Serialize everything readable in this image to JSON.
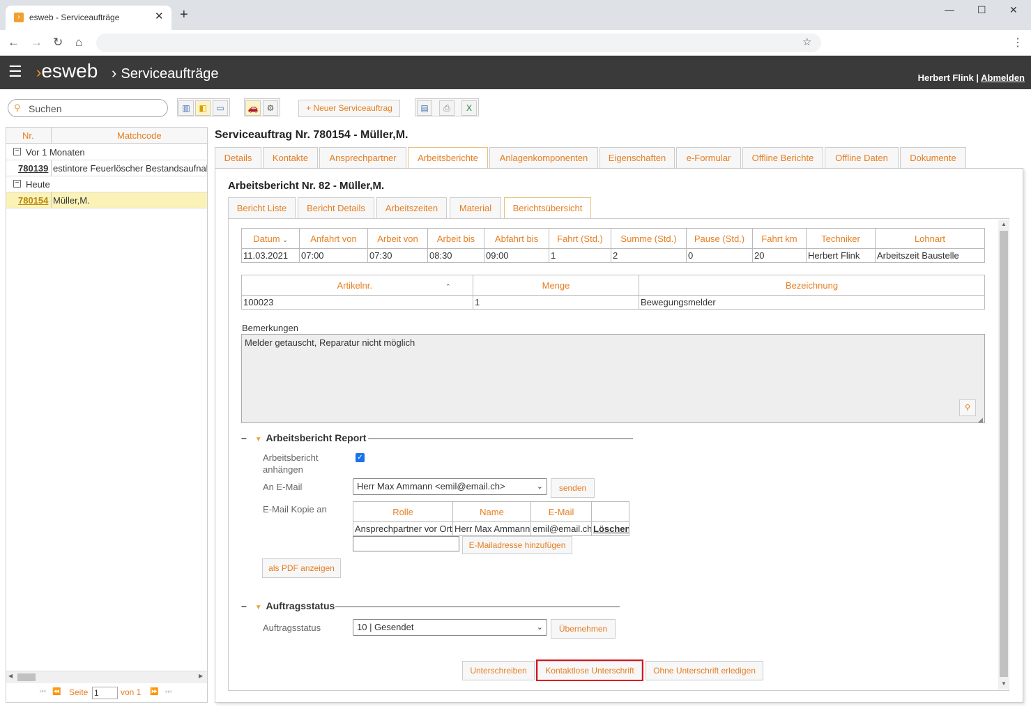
{
  "browser": {
    "tab_title": "esweb - Serviceaufträge",
    "tab_close": "✕",
    "new_tab": "+"
  },
  "app": {
    "logo": "esweb",
    "page_title": "Serviceaufträge",
    "user_name": "Herbert Flink",
    "separator": "|",
    "logout": "Abmelden"
  },
  "toolbar": {
    "search_placeholder": "Suchen",
    "new_order": "Neuer Serviceauftrag"
  },
  "left_list": {
    "col_nr": "Nr.",
    "col_matchcode": "Matchcode",
    "groups": [
      {
        "label": "Vor 1 Monaten",
        "toggle": "−",
        "rows": [
          {
            "nr": "780139",
            "matchcode": "estintore Feuerlöscher Bestandsaufnahme"
          }
        ]
      },
      {
        "label": "Heute",
        "toggle": "−",
        "rows": [
          {
            "nr": "780154",
            "matchcode": "Müller,M."
          }
        ]
      }
    ],
    "pager": {
      "page_label": "Seite",
      "page_value": "1",
      "of_label": "von 1"
    }
  },
  "main": {
    "title": "Serviceauftrag Nr. 780154 - Müller,M.",
    "tabs": [
      "Details",
      "Kontakte",
      "Ansprechpartner",
      "Arbeitsberichte",
      "Anlagenkomponenten",
      "Eigenschaften",
      "e-Formular",
      "Offline Berichte",
      "Offline Daten",
      "Dokumente"
    ],
    "active_tab": "Arbeitsberichte"
  },
  "report": {
    "title": "Arbeitsbericht Nr. 82 - Müller,M.",
    "tabs": [
      "Bericht Liste",
      "Bericht Details",
      "Arbeitszeiten",
      "Material",
      "Berichtsübersicht"
    ],
    "active_tab": "Berichtsübersicht",
    "time_table": {
      "headers": [
        "Datum",
        "Anfahrt von",
        "Arbeit von",
        "Arbeit bis",
        "Abfahrt bis",
        "Fahrt (Std.)",
        "Summe (Std.)",
        "Pause (Std.)",
        "Fahrt km",
        "Techniker",
        "Lohnart"
      ],
      "rows": [
        [
          "11.03.2021",
          "07:00",
          "07:30",
          "08:30",
          "09:00",
          "1",
          "2",
          "0",
          "20",
          "Herbert Flink",
          "Arbeitszeit Baustelle"
        ]
      ]
    },
    "material_table": {
      "headers": [
        "Artikelnr.",
        "Menge",
        "Bezeichnung"
      ],
      "rows": [
        [
          "100023",
          "1",
          "Bewegungsmelder"
        ]
      ]
    },
    "remarks_label": "Bemerkungen",
    "remarks_value": "Melder getauscht, Reparatur nicht möglich",
    "report_section": {
      "collapse": "–",
      "title": "Arbeitsbericht Report",
      "attach_label_1": "Arbeitsbericht",
      "attach_label_2": "anhängen",
      "attach_checked": true,
      "email_label": "An E-Mail",
      "email_value": "Herr Max Ammann <emil@email.ch>",
      "send_button": "senden",
      "cc_label": "E-Mail Kopie an",
      "cc_table": {
        "headers": [
          "Rolle",
          "Name",
          "E-Mail",
          ""
        ],
        "rows": [
          [
            "Ansprechpartner vor Ort",
            "Herr Max Ammann",
            "emil@email.ch",
            "Löschen"
          ]
        ]
      },
      "add_email_button": "E-Mailadresse hinzufügen",
      "pdf_button": "als PDF anzeigen"
    },
    "status_section": {
      "collapse": "–",
      "title": "Auftragsstatus",
      "label": "Auftragsstatus",
      "value": "10 | Gesendet",
      "apply_button": "Übernehmen"
    },
    "actions": {
      "sign": "Unterschreiben",
      "contactless": "Kontaktlose Unterschrift",
      "no_sign": "Ohne Unterschrift erledigen"
    }
  },
  "colors": {
    "accent": "#e67e22",
    "header_bg": "#3a3a3a",
    "highlight": "#e0101a",
    "selected_row": "#fbf2b8"
  }
}
